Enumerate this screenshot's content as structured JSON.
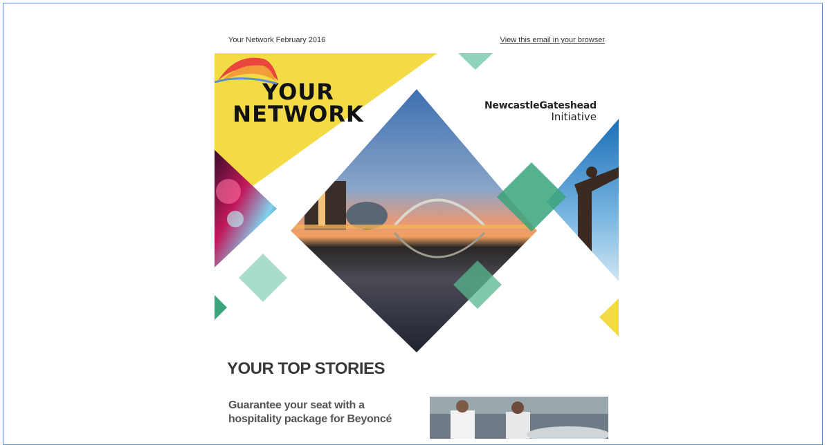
{
  "email": {
    "preheader": "Your Network February 2016",
    "view_in_browser": "View this email in your browser"
  },
  "hero": {
    "title_line1": "YOUR",
    "title_line2": "NETWORK",
    "logo_name": "NewcastleGateshead",
    "logo_sub": "Initiative",
    "colors": {
      "yellow": "#f2db45",
      "green": "#3aa57b",
      "mint": "#a9dccb"
    }
  },
  "top_stories": {
    "heading": "YOUR TOP STORIES",
    "items": [
      {
        "title": "Guarantee your seat with a hospitality package for Beyoncé"
      }
    ]
  }
}
